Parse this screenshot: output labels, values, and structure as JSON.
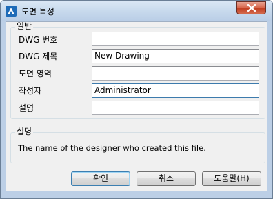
{
  "window": {
    "title": "도면 특성"
  },
  "general_group": {
    "legend": "일반",
    "fields": [
      {
        "label": "DWG 번호",
        "value": ""
      },
      {
        "label": "DWG 제목",
        "value": "New Drawing"
      },
      {
        "label": "도면 영역",
        "value": ""
      },
      {
        "label": "작성자",
        "value": "Administrator"
      },
      {
        "label": "설명",
        "value": ""
      }
    ]
  },
  "description_group": {
    "legend": "설명",
    "text": "The name of the designer who created this file."
  },
  "buttons": {
    "ok_label": "확인",
    "cancel_label": "취소",
    "help_label": "도움말(H)"
  },
  "colors": {
    "accent": "#3d7bad",
    "app_icon": "#1e6bb8",
    "close_button": "#c84a2c"
  },
  "icons": {
    "app": "autocad-a-icon",
    "close": "close-icon"
  }
}
